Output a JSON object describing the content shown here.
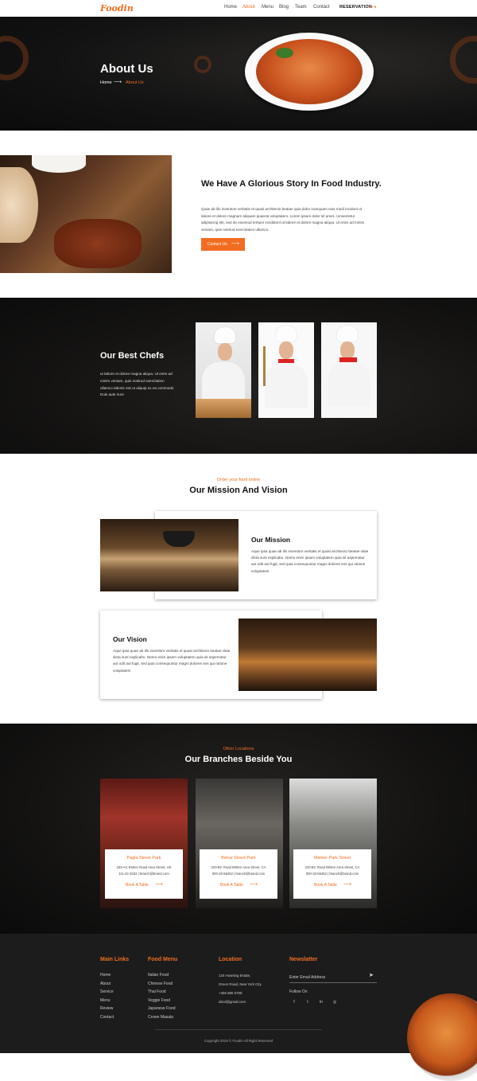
{
  "nav": {
    "logo": "Foodin",
    "links": [
      "Home",
      "About",
      "Menu",
      "Blog",
      "Team",
      "Contact"
    ],
    "active": "About",
    "reservation": "RESERVATION",
    "arrow": "⟶"
  },
  "hero": {
    "title": "About Us",
    "crumb_home": "Home",
    "crumb_sep": "⟶",
    "crumb_current": "About Us"
  },
  "story": {
    "title": "We Have A Glorious Story In Food Industry.",
    "text": "Quae ab illo inventore veritatis et quasi architecto beatae quia dolor numquam eius modi incidunt ut labore et dolore magnam aliquam quaerat voluptatem. Lorem ipsum dolor sit amet, consectetur adipisicing elit, sed do eiusmod tempor incididunt ut labore et dolore magna aliqua. Ut enim ad minim veniam, quis nostrud exercitation ullamco.",
    "button": "Contact Us",
    "arrow": "⟶"
  },
  "chefs": {
    "title": "Our Best Chefs",
    "text": "ut labore et dolore magna aliqua. Ut enim ad minim veniam, quis nostrud exercitation ullamco laboris nisi ut aliquip ex ea commodo Duis aute irure"
  },
  "mission_vision": {
    "eyebrow": "Order your food online",
    "title": "Our Mission And Vision",
    "mission": {
      "title": "Our Mission",
      "text": "Aque ipsa quae ab illo inventore veritatis et quasi architecto beatae vitae dicta sunt explicabo. Nemo enim ipsam voluptatem quia sit aspernatur aut odit aut fugit, sed quia consequuntur magni dolores eos qui ratione voluptatem"
    },
    "vision": {
      "title": "Our Vision",
      "text": "Aque ipsa quae ab illo inventore veritatis et quasi architecto beatae vitae dicta sunt explicabo. Nemo enim ipsam voluptatem quia sit aspernatur aut odit aut fugit, sed quia consequuntur magni dolores eos qui ratione voluptatem"
    }
  },
  "branches": {
    "eyebrow": "Other Locations",
    "title": "Our Branches Beside You",
    "items": [
      {
        "name": "Pagla Street Park",
        "address": "333-AC Britten Road Area Street, US",
        "phone": "111-22-3333 | branch@brand.com",
        "link": "Book A Table",
        "arrow": "⟶"
      },
      {
        "name": "Bekar Street Park",
        "address": "220-BC Road Britten Area Street, CA",
        "phone": "000-33-56452 | branch@brand.com",
        "link": "Book A Table",
        "arrow": "⟶"
      },
      {
        "name": "Marker Park Street",
        "address": "220-BC Road Britten Area Street, CA",
        "phone": "000-33-56452 | branch@brand.com",
        "link": "Book A Table",
        "arrow": "⟶"
      }
    ]
  },
  "footer": {
    "main_links": {
      "title": "Main Links",
      "items": [
        "Home",
        "About",
        "Service",
        "Menu",
        "Review",
        "Contact"
      ]
    },
    "food_menu": {
      "title": "Food Menu",
      "items": [
        "Italian Food",
        "Chinese Food",
        "Thai Food",
        "Veggie Food",
        "Japanese Food",
        "Crown Masala"
      ]
    },
    "location": {
      "title": "Location",
      "lines": [
        "134 Howsing Estate,",
        "Green Road, New York City",
        "+456 896 5768",
        "abcd@gmail.com"
      ]
    },
    "newsletter": {
      "title": "Newslatter",
      "placeholder": "Enter Email Address",
      "send_icon": "➤",
      "follow": "Follow On",
      "social": [
        "f",
        "t",
        "in",
        "◎"
      ]
    },
    "copyright": "Copyright 2019 © Foodin All Right Reserved"
  },
  "colors": {
    "accent": "#f26d21",
    "dark": "#141312",
    "footer": "#1c1c1c"
  }
}
